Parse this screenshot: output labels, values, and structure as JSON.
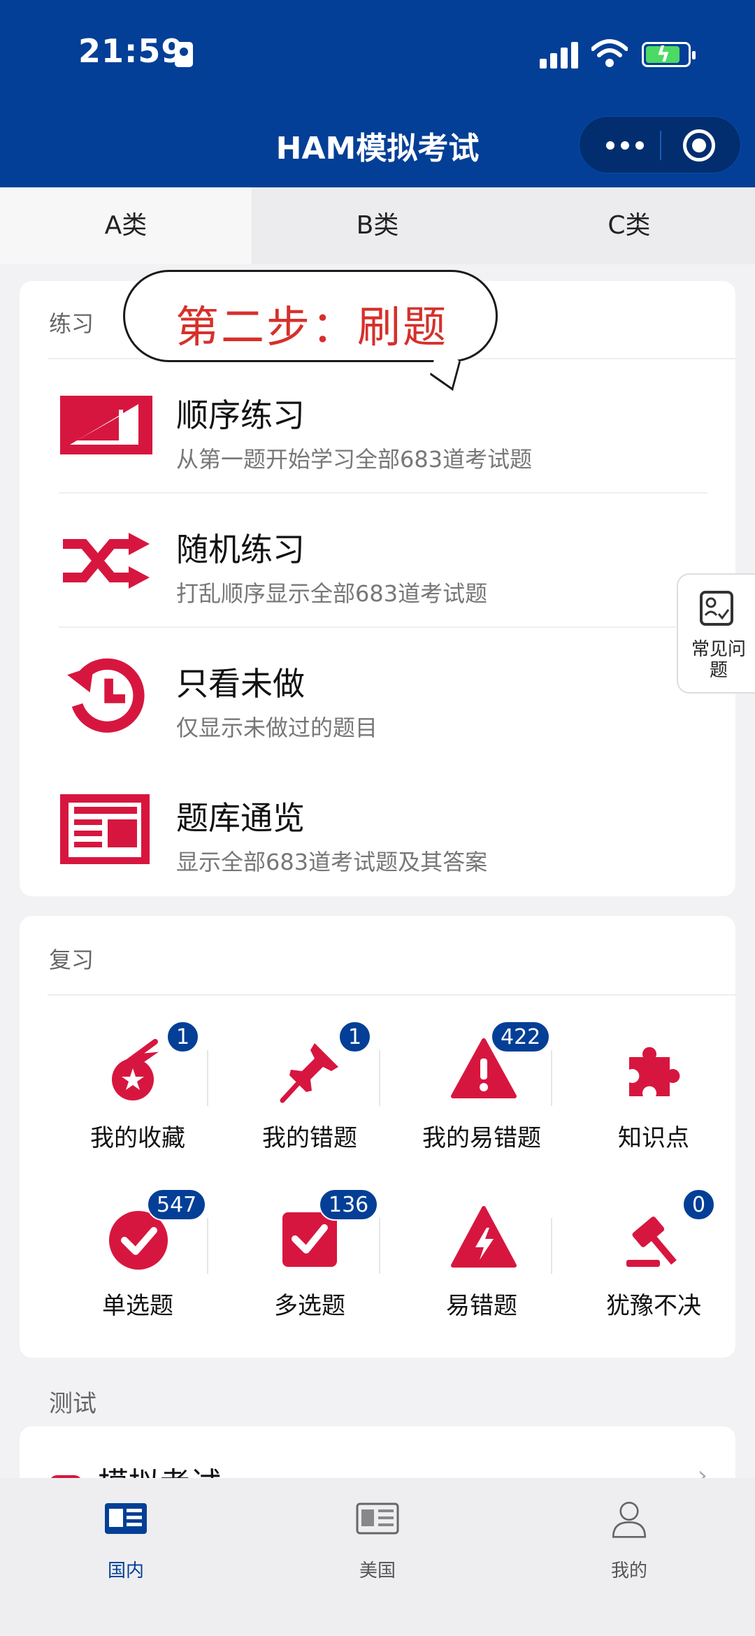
{
  "status_bar": {
    "time": "21:59"
  },
  "header": {
    "title": "HAM模拟考试"
  },
  "tabs": [
    {
      "label": "A类",
      "active": true
    },
    {
      "label": "B类",
      "active": false
    },
    {
      "label": "C类",
      "active": false
    }
  ],
  "practice": {
    "section_title": "练习",
    "callout": "第二步：刷题",
    "items": [
      {
        "title": "顺序练习",
        "subtitle": "从第一题开始学习全部683道考试题",
        "icon": "sequence-icon"
      },
      {
        "title": "随机练习",
        "subtitle": "打乱顺序显示全部683道考试题",
        "icon": "shuffle-icon"
      },
      {
        "title": "只看未做",
        "subtitle": "仅显示未做过的题目",
        "icon": "history-clock-icon"
      },
      {
        "title": "题库通览",
        "subtitle": "显示全部683道考试题及其答案",
        "icon": "newspaper-icon"
      }
    ]
  },
  "review": {
    "section_title": "复习",
    "items": [
      {
        "label": "我的收藏",
        "badge": "1",
        "icon": "favorite-comet-icon"
      },
      {
        "label": "我的错题",
        "badge": "1",
        "icon": "pushpin-icon"
      },
      {
        "label": "我的易错题",
        "badge": "422",
        "icon": "warning-icon"
      },
      {
        "label": "知识点",
        "badge": "",
        "icon": "puzzle-icon"
      },
      {
        "label": "单选题",
        "badge": "547",
        "icon": "check-circle-icon"
      },
      {
        "label": "多选题",
        "badge": "136",
        "icon": "check-square-icon"
      },
      {
        "label": "易错题",
        "badge": "",
        "icon": "lightning-triangle-icon"
      },
      {
        "label": "犹豫不决",
        "badge": "0",
        "icon": "gavel-icon"
      }
    ]
  },
  "test": {
    "section_title": "测试",
    "item_title": "模拟考试"
  },
  "faq": {
    "label": "常见问题"
  },
  "bottom_nav": [
    {
      "label": "国内",
      "active": true,
      "icon": "domestic-news-icon"
    },
    {
      "label": "美国",
      "active": false,
      "icon": "us-news-icon"
    },
    {
      "label": "我的",
      "active": false,
      "icon": "profile-icon"
    }
  ],
  "colors": {
    "header_blue": "#033f96",
    "accent_red": "#d7163f",
    "callout_red": "#d6302b"
  }
}
